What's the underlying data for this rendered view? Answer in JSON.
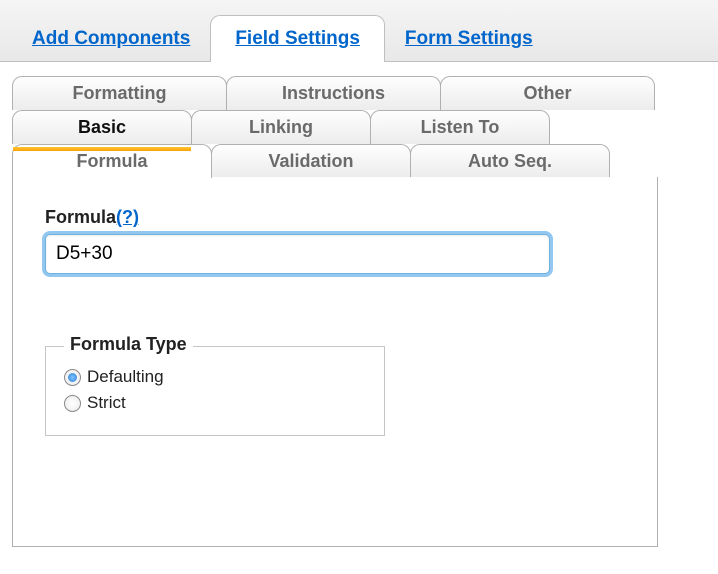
{
  "topnav": {
    "add_components": "Add Components",
    "field_settings": "Field Settings",
    "form_settings": "Form Settings"
  },
  "tabs": {
    "row1": {
      "formatting": "Formatting",
      "instructions": "Instructions",
      "other": "Other"
    },
    "row2": {
      "basic": "Basic",
      "linking": "Linking",
      "listen_to": "Listen To"
    },
    "row3": {
      "formula": "Formula",
      "validation": "Validation",
      "auto_seq": "Auto Seq."
    }
  },
  "formula": {
    "label": "Formula",
    "help_link": "(?)",
    "value": "D5+30"
  },
  "formula_type": {
    "legend": "Formula Type",
    "options": {
      "defaulting": {
        "label": "Defaulting",
        "checked": true
      },
      "strict": {
        "label": "Strict",
        "checked": false
      }
    }
  }
}
